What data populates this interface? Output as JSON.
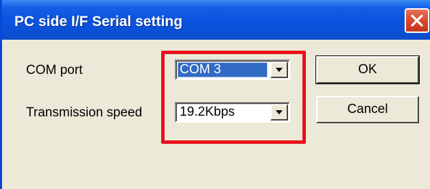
{
  "window": {
    "title": "PC side I/F  Serial setting"
  },
  "titlebar": {
    "close_icon": "close-icon",
    "close_color": "#d9482f"
  },
  "form": {
    "com_port": {
      "label": "COM port",
      "value": "COM 3"
    },
    "transmission_speed": {
      "label": "Transmission speed",
      "value": "19.2Kbps"
    }
  },
  "buttons": {
    "ok_label": "OK",
    "cancel_label": "Cancel"
  },
  "colors": {
    "titlebar": "#0a50d8",
    "highlight_box": "#e8101a",
    "selection": "#316ac5",
    "dialog_bg": "#ece9d8"
  }
}
